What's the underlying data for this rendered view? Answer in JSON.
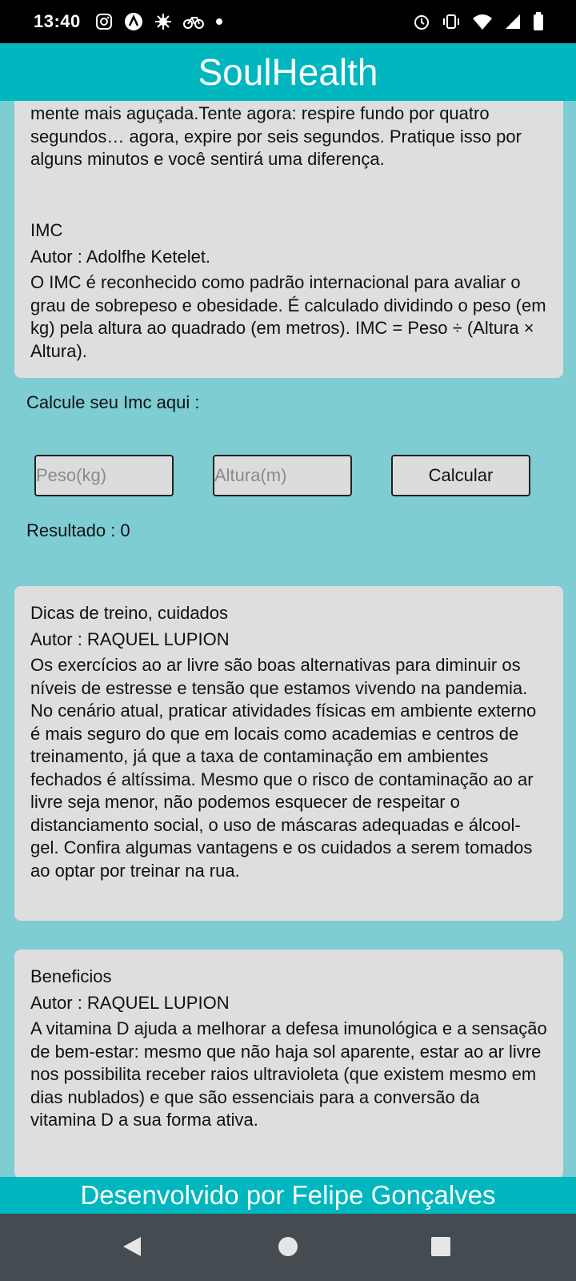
{
  "status": {
    "time": "13:40",
    "left_icons": [
      "instagram-icon",
      "app-a-icon",
      "bug-icon",
      "bike-icon",
      "dot-icon"
    ],
    "right_icons": [
      "alarm-icon",
      "vibrate-icon",
      "wifi-icon",
      "signal-icon",
      "battery-icon"
    ]
  },
  "app": {
    "title": "SoulHealth"
  },
  "cards": [
    {
      "body": "mente mais aguçada.Tente agora: respire fundo por quatro segundos… agora, expire por seis segundos. Pratique isso por alguns minutos e você sentirá uma diferença."
    },
    {
      "title": "IMC",
      "author": "Autor : Adolfhe Ketelet.",
      "body": "O IMC é reconhecido como padrão internacional para avaliar o grau de sobrepeso e obesidade. É calculado dividindo o peso (em kg) pela altura ao quadrado (em metros). IMC = Peso ÷ (Altura × Altura)."
    },
    {
      "title": "Dicas de treino, cuidados",
      "author": "Autor : RAQUEL LUPION",
      "body": "Os exercícios ao ar livre são boas alternativas para diminuir os níveis de estresse e tensão que estamos vivendo na pandemia. No cenário atual, praticar atividades físicas em ambiente externo é mais seguro do que em locais como academias e centros de treinamento, já que a taxa de contaminação em ambientes fechados é altíssima.  Mesmo que o risco de contaminação ao ar livre seja menor, não podemos esquecer de respeitar o distanciamento social, o uso de máscaras adequadas e álcool-gel. Confira algumas vantagens e os cuidados a serem tomados ao optar por treinar na rua."
    },
    {
      "title": "Beneficios",
      "author": "Autor : RAQUEL LUPION",
      "body": "A vitamina D ajuda a melhorar a defesa imunológica e a sensação de bem-estar: mesmo que não haja sol aparente, estar ao ar livre nos possibilita receber raios ultravioleta (que existem mesmo em dias nublados) e que são essenciais para a conversão da vitamina D a sua forma ativa."
    }
  ],
  "calc": {
    "label": "Calcule seu Imc aqui :",
    "peso_placeholder": "Peso(kg)",
    "altura_placeholder": "Altura(m)",
    "button": "Calcular",
    "result": "Resultado : 0"
  },
  "footer": {
    "text": "Desenvolvido por Felipe Gonçalves"
  },
  "nav": {
    "icons": [
      "back-icon",
      "home-icon",
      "recents-icon"
    ]
  }
}
